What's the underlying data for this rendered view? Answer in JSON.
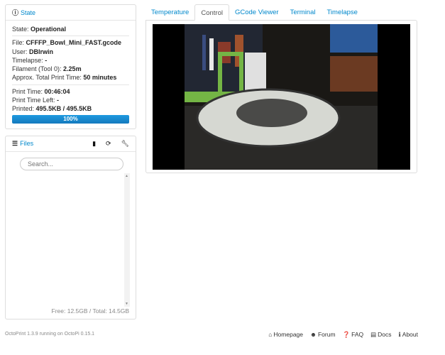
{
  "state_panel": {
    "title": "State",
    "icon": "info-circle-icon",
    "state_label": "State:",
    "state_value": "Operational",
    "file_label": "File:",
    "file_value": "CFFFP_Bowl_Mini_FAST.gcode",
    "user_label": "User:",
    "user_value": "DBIrwin",
    "timelapse_label": "Timelapse:",
    "timelapse_value": "-",
    "filament_label": "Filament (Tool 0):",
    "filament_value": "2.25m",
    "approx_label": "Approx. Total Print Time:",
    "approx_value": "50 minutes",
    "print_time_label": "Print Time:",
    "print_time_value": "00:46:04",
    "time_left_label": "Print Time Left:",
    "time_left_value": "-",
    "printed_label": "Printed:",
    "printed_value": "495.5KB / 495.5KB",
    "progress_percent": 100,
    "progress_text": "100%"
  },
  "files_panel": {
    "title": "Files",
    "icon": "list-icon",
    "search_placeholder": "Search...",
    "storage": "Free: 12.5GB / Total: 14.5GB",
    "tools": [
      "upload-file-icon",
      "refresh-icon",
      "wrench-icon"
    ]
  },
  "tabs": [
    {
      "label": "Temperature"
    },
    {
      "label": "Control",
      "active": true
    },
    {
      "label": "GCode Viewer"
    },
    {
      "label": "Terminal"
    },
    {
      "label": "Timelapse"
    }
  ],
  "footer": {
    "version": "OctoPrint 1.3.9 running on OctoPi 0.15.1",
    "links": [
      {
        "label": "Homepage",
        "icon": "home-icon",
        "glyph": "⌂"
      },
      {
        "label": "Forum",
        "icon": "group-icon",
        "glyph": "☻"
      },
      {
        "label": "FAQ",
        "icon": "question-circle-icon",
        "glyph": "❓"
      },
      {
        "label": "Docs",
        "icon": "book-icon",
        "glyph": "▤"
      },
      {
        "label": "About",
        "icon": "info-circle-icon",
        "glyph": "ℹ"
      }
    ]
  }
}
